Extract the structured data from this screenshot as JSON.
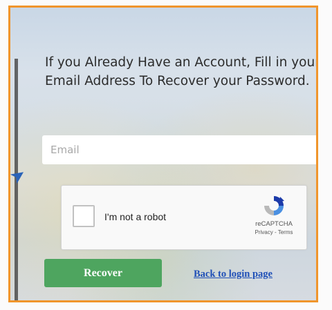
{
  "message": "If you Already Have an Account, Fill in your Email Address To Recover your Password.",
  "email": {
    "placeholder": "Email",
    "value": ""
  },
  "captcha": {
    "label": "I'm not a robot",
    "brand": "reCAPTCHA",
    "links": "Privacy - Terms"
  },
  "actions": {
    "recover_label": "Recover",
    "back_label": "Back to login page"
  },
  "colors": {
    "frame_border": "#f0952c",
    "recover_button": "#4ea55f",
    "link": "#1f4fb7"
  }
}
